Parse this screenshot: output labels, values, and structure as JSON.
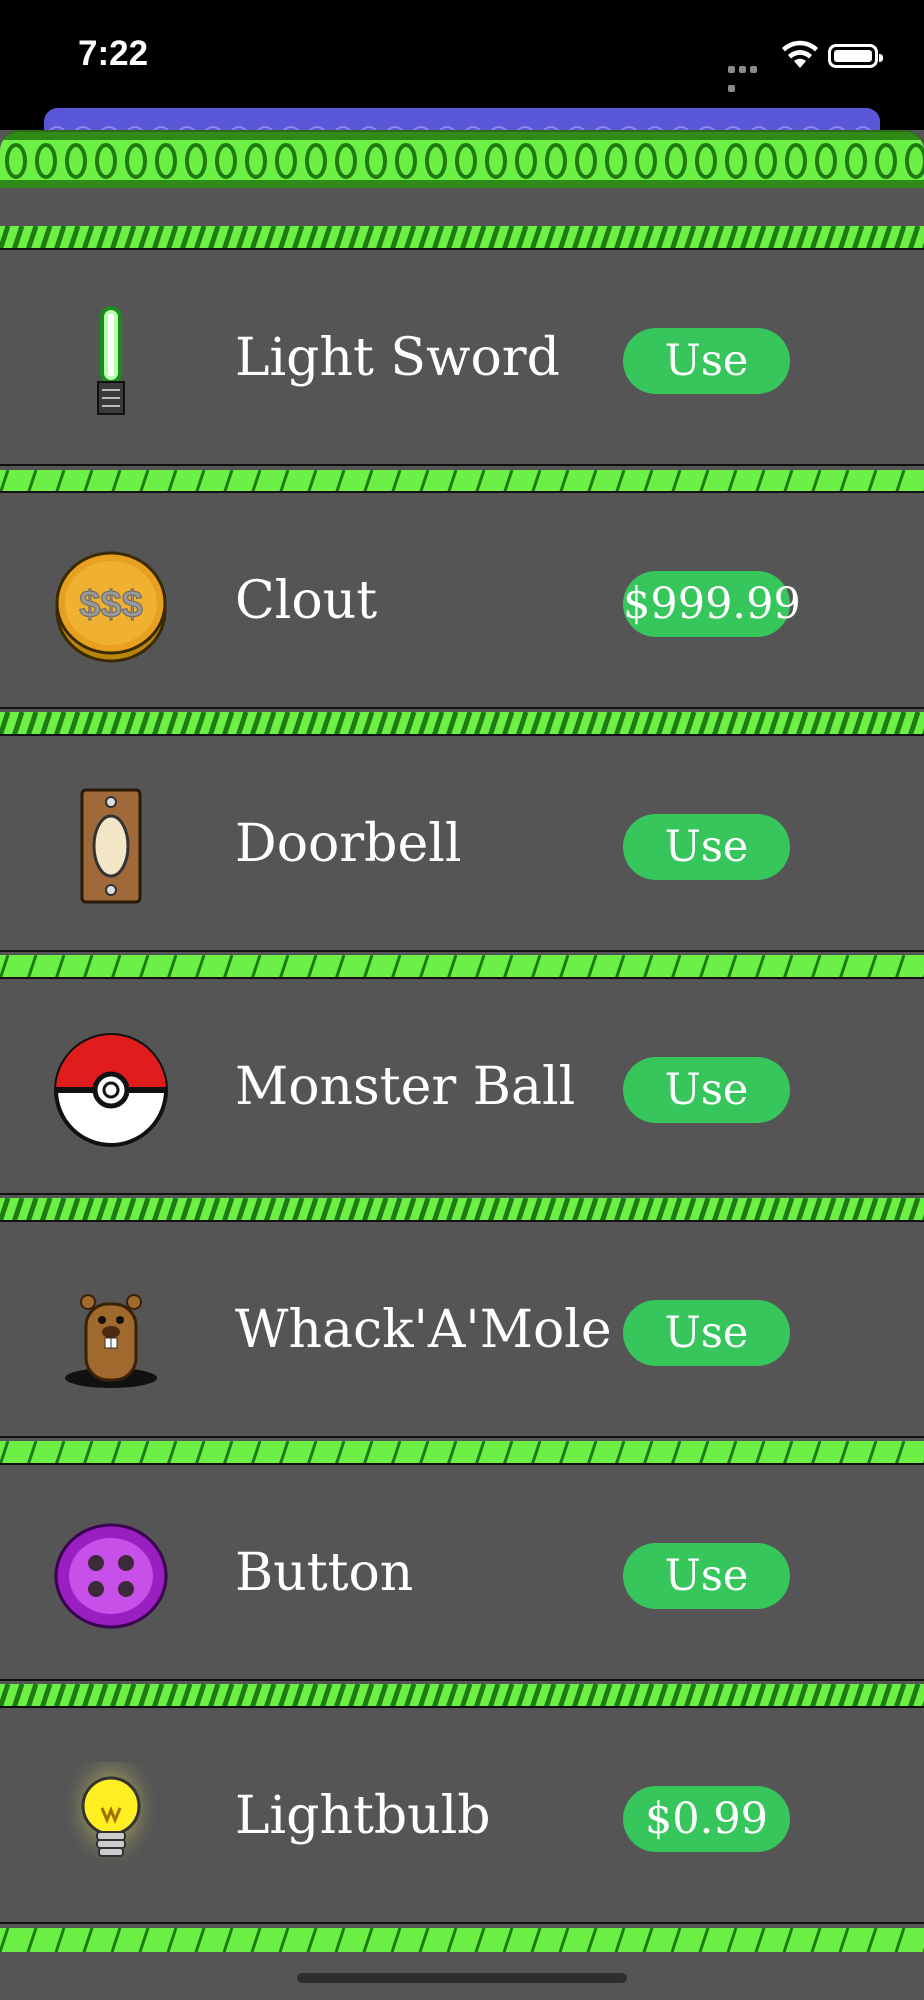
{
  "status_bar": {
    "time": "7:22"
  },
  "colors": {
    "accent_green": "#36c65c",
    "row_bg": "#555555",
    "stripe_green": "#6df046",
    "stripe_dark": "#1f7a12",
    "purple": "#5a56d8"
  },
  "items": [
    {
      "name": "Light Sword",
      "button": "Use",
      "icon": "light-sword-icon"
    },
    {
      "name": "Clout",
      "button": "$999.99",
      "icon": "coin-icon"
    },
    {
      "name": "Doorbell",
      "button": "Use",
      "icon": "doorbell-icon"
    },
    {
      "name": "Monster Ball",
      "button": "Use",
      "icon": "monster-ball-icon"
    },
    {
      "name": "Whack'A'Mole",
      "button": "Use",
      "icon": "mole-icon"
    },
    {
      "name": "Button",
      "button": "Use",
      "icon": "sewing-button-icon"
    },
    {
      "name": "Lightbulb",
      "button": "$0.99",
      "icon": "lightbulb-icon"
    }
  ]
}
